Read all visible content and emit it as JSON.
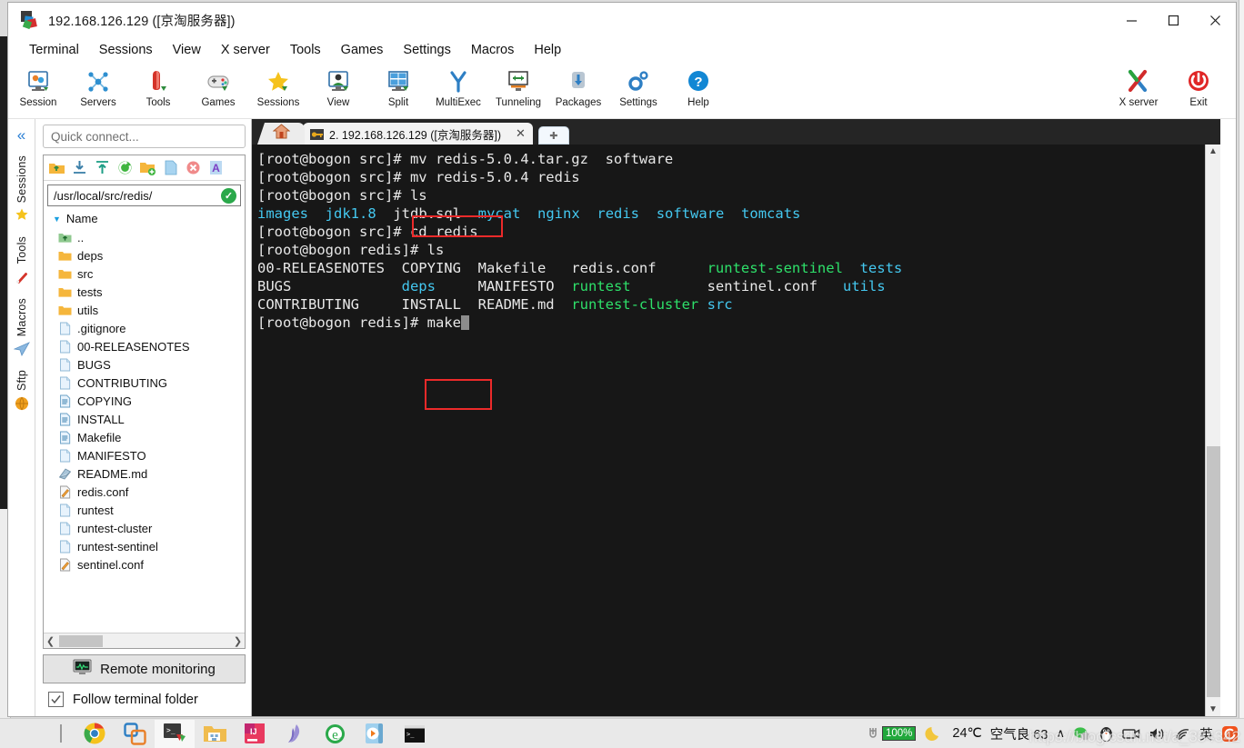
{
  "window": {
    "title": "192.168.126.129 ([京淘服务器])",
    "controls": {
      "minimize": "—",
      "maximize": "□",
      "close": "✕"
    }
  },
  "menubar": {
    "items": [
      "Terminal",
      "Sessions",
      "View",
      "X server",
      "Tools",
      "Games",
      "Settings",
      "Macros",
      "Help"
    ]
  },
  "toolbar": {
    "buttons": [
      {
        "label": "Session",
        "icon": "session-icon"
      },
      {
        "label": "Servers",
        "icon": "servers-icon"
      },
      {
        "label": "Tools",
        "icon": "tools-icon"
      },
      {
        "label": "Games",
        "icon": "games-icon"
      },
      {
        "label": "Sessions",
        "icon": "sessions-star-icon"
      },
      {
        "label": "View",
        "icon": "view-icon"
      },
      {
        "label": "Split",
        "icon": "split-icon"
      },
      {
        "label": "MultiExec",
        "icon": "multiexec-icon"
      },
      {
        "label": "Tunneling",
        "icon": "tunneling-icon"
      },
      {
        "label": "Packages",
        "icon": "packages-icon"
      },
      {
        "label": "Settings",
        "icon": "settings-gear-icon"
      },
      {
        "label": "Help",
        "icon": "help-question-icon"
      }
    ],
    "right_buttons": [
      {
        "label": "X server",
        "icon": "x-server-icon"
      },
      {
        "label": "Exit",
        "icon": "power-exit-icon"
      }
    ]
  },
  "vertical_tabs": [
    {
      "label": "Sessions",
      "icon": "star-icon"
    },
    {
      "label": "Tools",
      "icon": "wrench-icon"
    },
    {
      "label": "Macros",
      "icon": "paper-plane-icon"
    },
    {
      "label": "Sftp",
      "icon": "globe-icon"
    }
  ],
  "sidebar": {
    "quick_connect_placeholder": "Quick connect...",
    "browser_toolbar_icons": [
      "go-up-folder-icon",
      "download-icon",
      "upload-icon",
      "refresh-icon",
      "new-folder-icon",
      "new-file-icon",
      "delete-icon",
      "text-edit-icon"
    ],
    "path": "/usr/local/src/redis/",
    "path_valid": true,
    "column_header": "Name",
    "files": [
      {
        "name": "..",
        "type": "parent"
      },
      {
        "name": "deps",
        "type": "folder"
      },
      {
        "name": "src",
        "type": "folder"
      },
      {
        "name": "tests",
        "type": "folder"
      },
      {
        "name": "utils",
        "type": "folder"
      },
      {
        "name": ".gitignore",
        "type": "file"
      },
      {
        "name": "00-RELEASENOTES",
        "type": "file"
      },
      {
        "name": "BUGS",
        "type": "file"
      },
      {
        "name": "CONTRIBUTING",
        "type": "file"
      },
      {
        "name": "COPYING",
        "type": "doc"
      },
      {
        "name": "INSTALL",
        "type": "doc"
      },
      {
        "name": "Makefile",
        "type": "doc"
      },
      {
        "name": "MANIFESTO",
        "type": "file"
      },
      {
        "name": "README.md",
        "type": "md"
      },
      {
        "name": "redis.conf",
        "type": "conf"
      },
      {
        "name": "runtest",
        "type": "file"
      },
      {
        "name": "runtest-cluster",
        "type": "file"
      },
      {
        "name": "runtest-sentinel",
        "type": "file"
      },
      {
        "name": "sentinel.conf",
        "type": "conf"
      }
    ],
    "remote_monitoring_label": "Remote monitoring",
    "follow_terminal_label": "Follow terminal folder",
    "follow_terminal_checked": true
  },
  "tabbar": {
    "home_tab": "home-icon",
    "session_tab": "2.  192.168.126.129  ([京淘服务器])",
    "close_label": "✕",
    "new_tab_label": "✚"
  },
  "terminal": {
    "colors": {
      "background": "#171717",
      "text": "#e6e6e6",
      "dir": "#44c8f0",
      "exec": "#2ee06a"
    },
    "lines": [
      {
        "segments": [
          {
            "t": "[root@bogon src]# mv redis-5.0.4.tar.gz  software",
            "c": "plain"
          }
        ]
      },
      {
        "segments": [
          {
            "t": "[root@bogon src]# mv redis-5.0.4 redis",
            "c": "plain"
          }
        ]
      },
      {
        "segments": [
          {
            "t": "[root@bogon src]# ls",
            "c": "plain"
          }
        ]
      },
      {
        "segments": [
          {
            "t": "images",
            "c": "dir"
          },
          {
            "t": "  ",
            "c": "plain"
          },
          {
            "t": "jdk1.8",
            "c": "dir"
          },
          {
            "t": "  ",
            "c": "plain"
          },
          {
            "t": "jtdb.sql",
            "c": "plain"
          },
          {
            "t": "  ",
            "c": "plain"
          },
          {
            "t": "mycat",
            "c": "dir"
          },
          {
            "t": "  ",
            "c": "plain"
          },
          {
            "t": "nginx",
            "c": "dir"
          },
          {
            "t": "  ",
            "c": "plain"
          },
          {
            "t": "redis",
            "c": "dir"
          },
          {
            "t": "  ",
            "c": "plain"
          },
          {
            "t": "software",
            "c": "dir"
          },
          {
            "t": "  ",
            "c": "plain"
          },
          {
            "t": "tomcats",
            "c": "dir"
          }
        ]
      },
      {
        "segments": [
          {
            "t": "[root@bogon src]# cd redis",
            "c": "plain"
          }
        ]
      },
      {
        "segments": [
          {
            "t": "[root@bogon redis]# ls",
            "c": "plain"
          }
        ]
      },
      {
        "segments": [
          {
            "t": "00-RELEASENOTES  COPYING  Makefile   redis.conf      ",
            "c": "plain"
          },
          {
            "t": "runtest-sentinel",
            "c": "exec"
          },
          {
            "t": "  ",
            "c": "plain"
          },
          {
            "t": "tests",
            "c": "dir"
          }
        ]
      },
      {
        "segments": [
          {
            "t": "BUGS             ",
            "c": "plain"
          },
          {
            "t": "deps",
            "c": "dir"
          },
          {
            "t": "     MANIFESTO  ",
            "c": "plain"
          },
          {
            "t": "runtest",
            "c": "exec"
          },
          {
            "t": "         sentinel.conf   ",
            "c": "plain"
          },
          {
            "t": "utils",
            "c": "dir"
          }
        ]
      },
      {
        "segments": [
          {
            "t": "CONTRIBUTING     INSTALL  README.md  ",
            "c": "plain"
          },
          {
            "t": "runtest-cluster",
            "c": "exec"
          },
          {
            "t": " ",
            "c": "plain"
          },
          {
            "t": "src",
            "c": "dir"
          }
        ]
      },
      {
        "segments": [
          {
            "t": "[root@bogon redis]# make",
            "c": "plain"
          }
        ],
        "cursor": true
      }
    ],
    "annotations": [
      {
        "name": "cd-redis-highlight",
        "target": "cd redis"
      },
      {
        "name": "make-highlight",
        "target": "make"
      }
    ]
  },
  "taskbar": {
    "apps": [
      {
        "name": "chrome-icon",
        "label": "Google Chrome"
      },
      {
        "name": "vmware-icon",
        "label": "VMware Workstation"
      },
      {
        "name": "mobaxterm-icon",
        "label": "MobaXterm",
        "active": true
      },
      {
        "name": "file-explorer-icon",
        "label": "File Explorer"
      },
      {
        "name": "intellij-idea-icon",
        "label": "IntelliJ IDEA"
      },
      {
        "name": "navicat-icon",
        "label": "Navicat"
      },
      {
        "name": "internet-explorer-icon",
        "label": "Internet Explorer"
      },
      {
        "name": "media-player-icon",
        "label": "Media Player"
      },
      {
        "name": "terminal-icon",
        "label": "Terminal"
      }
    ],
    "tray": {
      "battery_percent": "100%",
      "weather_icon": "moon-icon",
      "temperature": "24℃",
      "air_quality": "空气良 63",
      "chevron": "∧",
      "icons": [
        "wechat-icon",
        "qq-penguin-icon",
        "camera-icon",
        "volume-icon",
        "wifi-icon",
        "ime-chinese-icon",
        "sogou-icon"
      ]
    },
    "watermark": "https://blog.csdn.net/a_354342",
    "watermark_small": "2\n202"
  }
}
